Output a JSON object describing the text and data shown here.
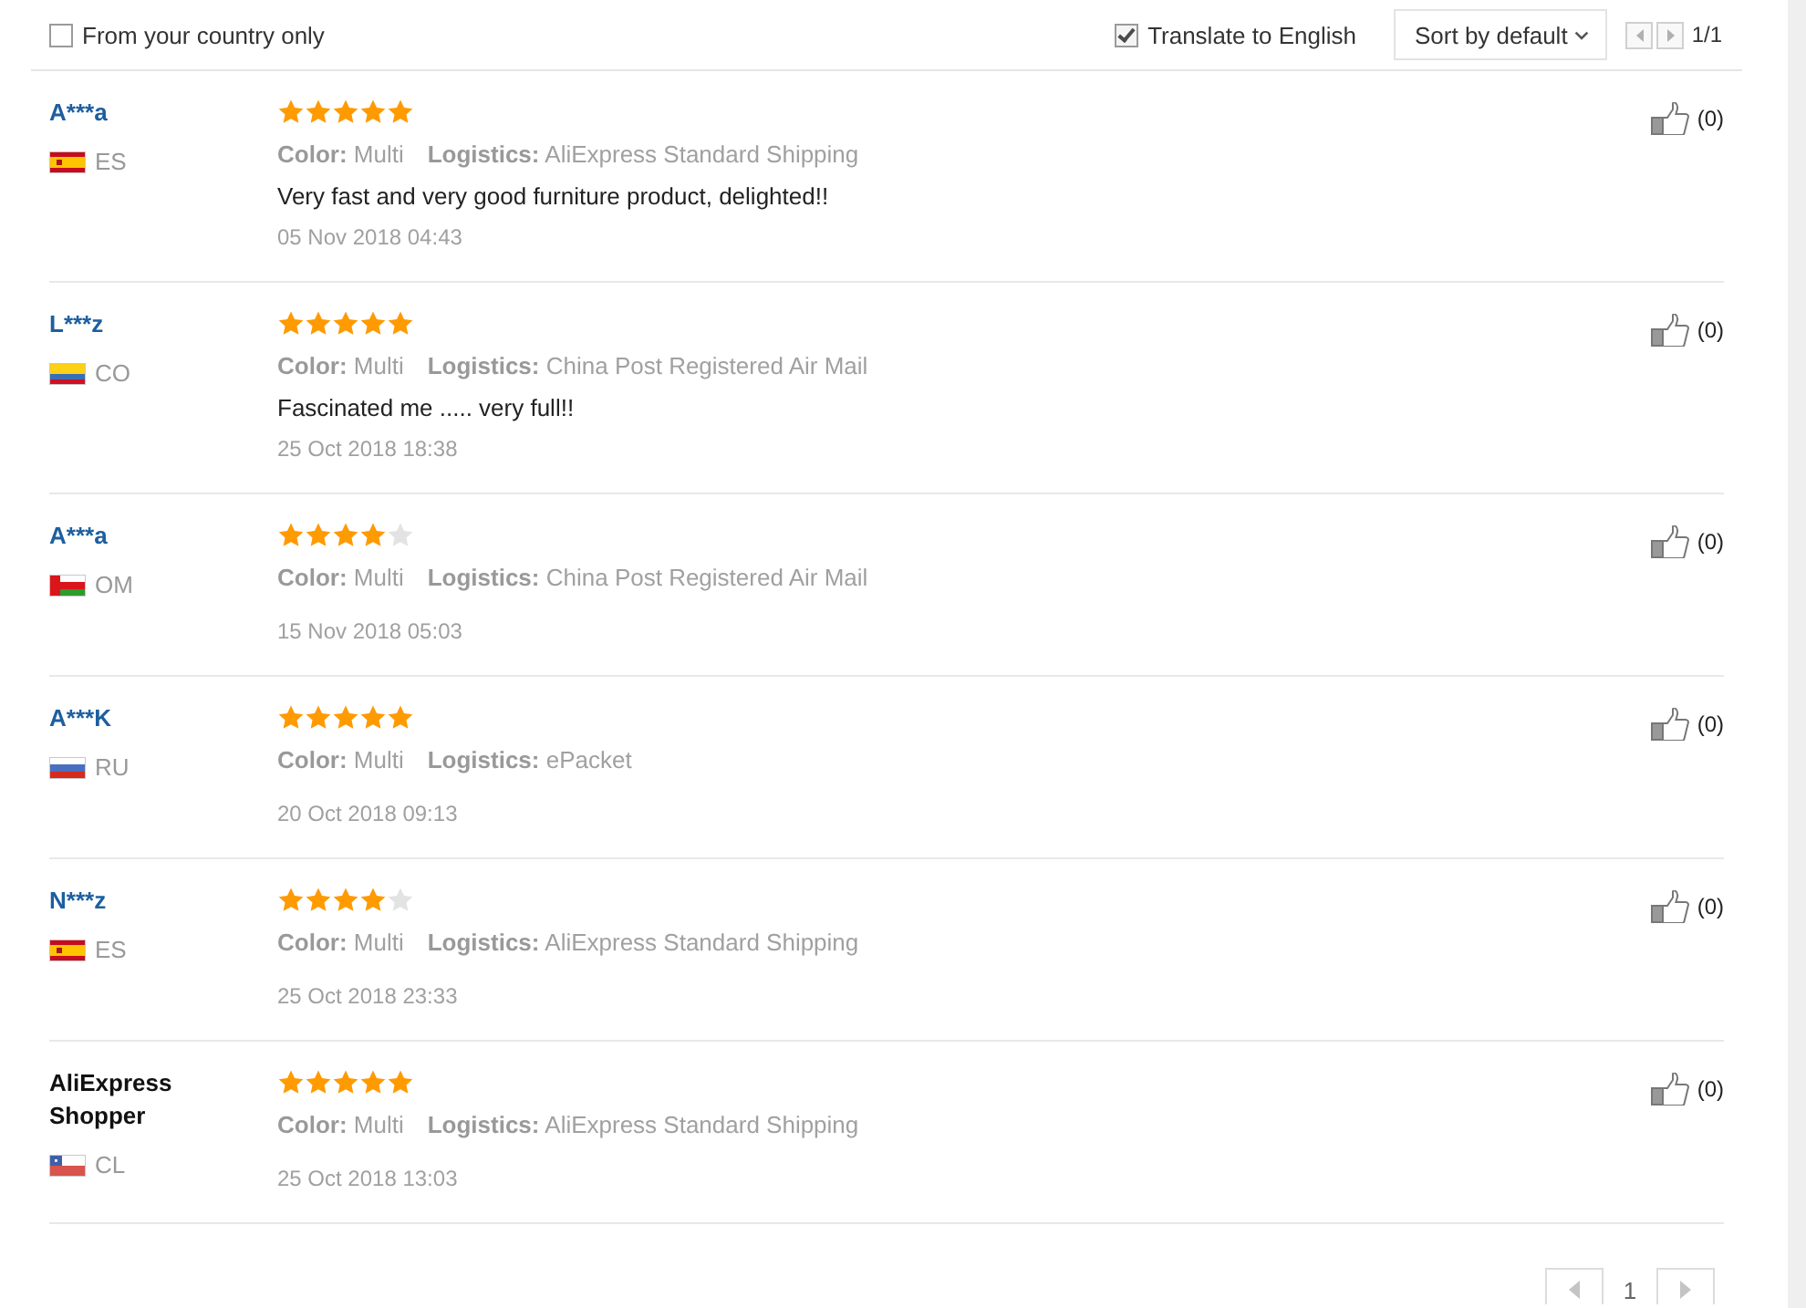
{
  "filters": [
    {
      "label": "From your country only",
      "checked": false
    },
    {
      "label": "Translate to English",
      "checked": true
    }
  ],
  "sort": {
    "label": "Sort by default"
  },
  "pager": {
    "indicator": "1/1"
  },
  "reviews": [
    {
      "name": "A***a",
      "linked": true,
      "country": "ES",
      "flag": {
        "kind": "spain"
      },
      "stars": 5,
      "attributes": [
        "**Color:** Multi",
        "**Logistics:** AliExpress Standard Shipping"
      ],
      "text": "Very fast and very good furniture product, delighted!!",
      "date": "05 Nov 2018 04:43",
      "likes": "(0)"
    },
    {
      "name": "L***z",
      "linked": true,
      "country": "CO",
      "flag": {
        "kind": "colombia"
      },
      "stars": 5,
      "attributes": [
        "**Color:** Multi",
        "**Logistics:** China Post Registered Air Mail"
      ],
      "text": "Fascinated me ..... very full!!",
      "date": "25 Oct 2018 18:38",
      "likes": "(0)"
    },
    {
      "name": "A***a",
      "linked": true,
      "country": "OM",
      "flag": {
        "kind": "oman"
      },
      "stars": 4,
      "attributes": [
        "**Color:** Multi",
        "**Logistics:** China Post Registered Air Mail"
      ],
      "date": "15 Nov 2018 05:03",
      "likes": "(0)"
    },
    {
      "name": "A***K",
      "linked": true,
      "country": "RU",
      "flag": {
        "kind": "russia"
      },
      "stars": 5,
      "attributes": [
        "**Color:** Multi",
        "**Logistics:** ePacket"
      ],
      "date": "20 Oct 2018 09:13",
      "likes": "(0)"
    },
    {
      "name": "N***z",
      "linked": true,
      "country": "ES",
      "flag": {
        "kind": "spain"
      },
      "stars": 4,
      "attributes": [
        "**Color:** Multi",
        "**Logistics:** AliExpress Standard Shipping"
      ],
      "date": "25 Oct 2018 23:33",
      "likes": "(0)"
    },
    {
      "name": "AliExpress Shopper",
      "linked": false,
      "country": "CL",
      "flag": {
        "kind": "chile"
      },
      "stars": 5,
      "attributes": [
        "**Color:** Multi",
        "**Logistics:** AliExpress Standard Shipping"
      ],
      "date": "25 Oct 2018 13:03",
      "likes": "(0)"
    }
  ],
  "pagination": {
    "pages": [
      {
        "label": "1",
        "selected": true
      }
    ]
  }
}
